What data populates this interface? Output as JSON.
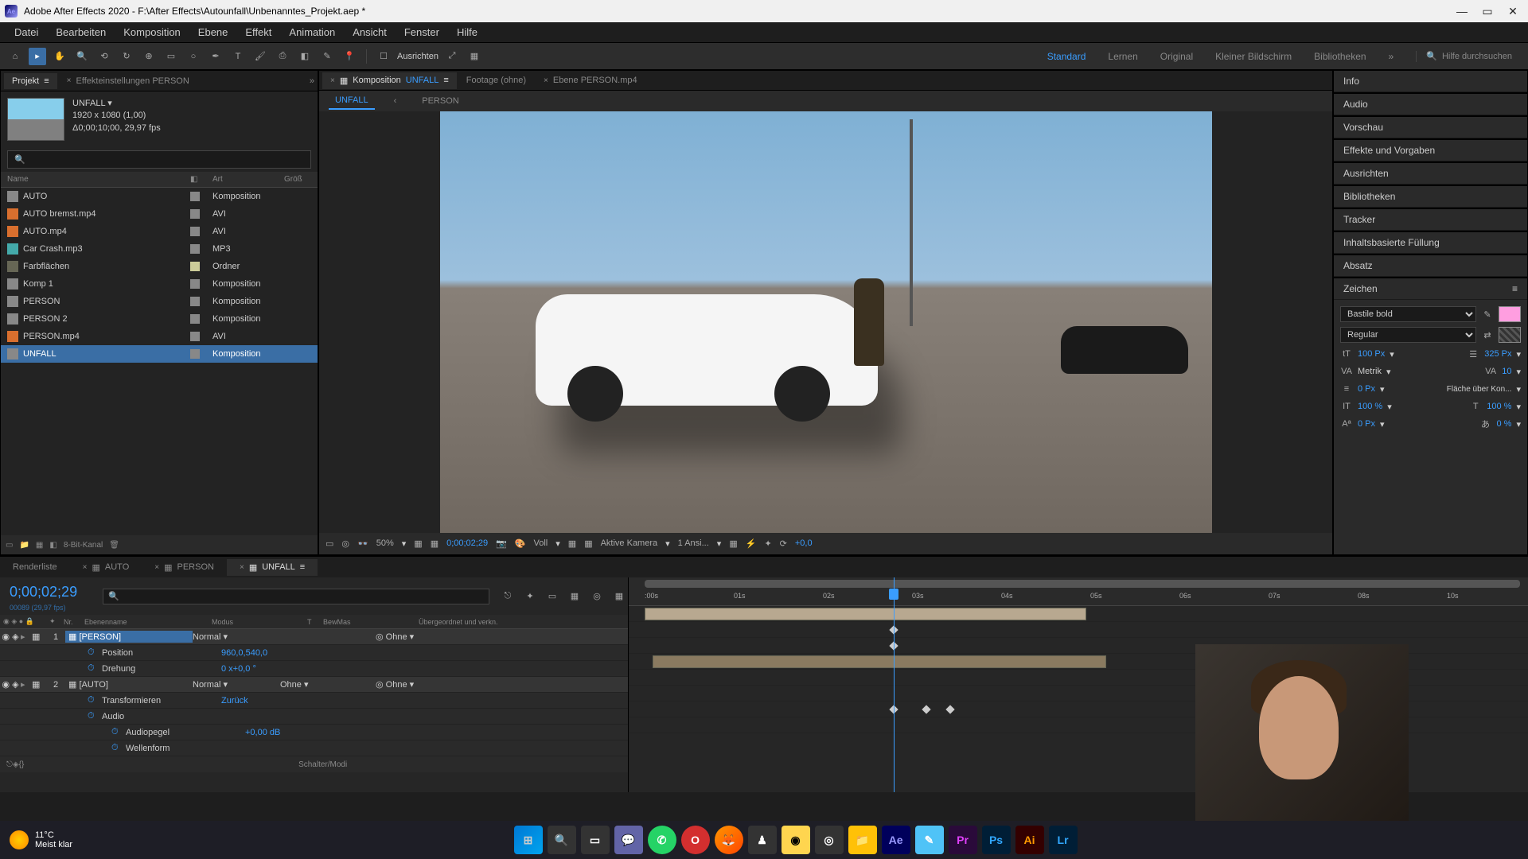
{
  "titlebar": {
    "app": "Adobe After Effects 2020",
    "path": "F:\\After Effects\\Autounfall\\Unbenanntes_Projekt.aep *"
  },
  "menu": [
    "Datei",
    "Bearbeiten",
    "Komposition",
    "Ebene",
    "Effekt",
    "Animation",
    "Ansicht",
    "Fenster",
    "Hilfe"
  ],
  "toolbar": {
    "align_label": "Ausrichten",
    "workspaces": [
      "Standard",
      "Lernen",
      "Original",
      "Kleiner Bildschirm",
      "Bibliotheken"
    ],
    "active_workspace": "Standard",
    "search_placeholder": "Hilfe durchsuchen"
  },
  "project": {
    "tab_project": "Projekt",
    "tab_effects": "Effekteinstellungen PERSON",
    "info_name": "UNFALL ▾",
    "info_res": "1920 x 1080 (1,00)",
    "info_dur": "Δ0;00;10;00, 29,97 fps",
    "cols": {
      "name": "Name",
      "type": "Art",
      "size": "Größ"
    },
    "items": [
      {
        "name": "AUTO",
        "type": "Komposition",
        "icon": "comp",
        "tag": ""
      },
      {
        "name": "AUTO bremst.mp4",
        "type": "AVI",
        "icon": "vid",
        "tag": ""
      },
      {
        "name": "AUTO.mp4",
        "type": "AVI",
        "icon": "vid",
        "tag": ""
      },
      {
        "name": "Car Crash.mp3",
        "type": "MP3",
        "icon": "aud",
        "tag": ""
      },
      {
        "name": "Farbflächen",
        "type": "Ordner",
        "icon": "fold",
        "tag": "y"
      },
      {
        "name": "Komp 1",
        "type": "Komposition",
        "icon": "comp",
        "tag": ""
      },
      {
        "name": "PERSON",
        "type": "Komposition",
        "icon": "comp",
        "tag": ""
      },
      {
        "name": "PERSON 2",
        "type": "Komposition",
        "icon": "comp",
        "tag": ""
      },
      {
        "name": "PERSON.mp4",
        "type": "AVI",
        "icon": "vid",
        "tag": ""
      },
      {
        "name": "UNFALL",
        "type": "Komposition",
        "icon": "comp",
        "tag": "",
        "selected": true
      }
    ],
    "footer_bpc": "8-Bit-Kanal"
  },
  "composition": {
    "tab_comp_prefix": "Komposition",
    "tab_comp_name": "UNFALL",
    "tab_footage": "Footage (ohne)",
    "tab_layer": "Ebene PERSON.mp4",
    "subtab_active": "UNFALL",
    "subtab_other": "PERSON",
    "controls": {
      "zoom": "50%",
      "timecode": "0;00;02;29",
      "res": "Voll",
      "camera": "Aktive Kamera",
      "views": "1 Ansi...",
      "exposure": "+0,0"
    }
  },
  "right_panels": {
    "info": "Info",
    "audio": "Audio",
    "preview": "Vorschau",
    "effects": "Effekte und Vorgaben",
    "align": "Ausrichten",
    "libraries": "Bibliotheken",
    "tracker": "Tracker",
    "contentfill": "Inhaltsbasierte Füllung",
    "paragraph": "Absatz",
    "character": {
      "title": "Zeichen",
      "font": "Bastile bold",
      "style": "Regular",
      "size": "100 Px",
      "leading": "325 Px",
      "kerning": "Metrik",
      "tracking": "10",
      "stroke": "0 Px",
      "stroke_opt": "Fläche über Kon...",
      "vscale": "100 %",
      "hscale": "100 %",
      "baseline": "0 Px",
      "tsume": "0 %"
    }
  },
  "timeline": {
    "tabs": [
      "Renderliste",
      "AUTO",
      "PERSON",
      "UNFALL"
    ],
    "active_tab": "UNFALL",
    "timecode": "0;00;02;29",
    "timecode_sub": "00089 (29,97 fps)",
    "cols": {
      "nr": "Nr.",
      "name": "Ebenenname",
      "mode": "Modus",
      "t": "T",
      "matte": "BewMas",
      "parent": "Übergeordnet und verkn."
    },
    "ruler_ticks": [
      ":00s",
      "01s",
      "02s",
      "03s",
      "04s",
      "05s",
      "06s",
      "07s",
      "08s",
      "10s"
    ],
    "layers": [
      {
        "num": "1",
        "name": "[PERSON]",
        "mode": "Normal",
        "parent": "Ohne",
        "boxed": true,
        "props": [
          {
            "name": "Position",
            "value": "960,0,540,0"
          },
          {
            "name": "Drehung",
            "value": "0 x+0,0 °"
          }
        ]
      },
      {
        "num": "2",
        "name": "[AUTO]",
        "mode": "Normal",
        "matte": "Ohne",
        "parent": "Ohne",
        "props": [
          {
            "name": "Transformieren",
            "value": "Zurück"
          },
          {
            "name": "Audio",
            "value": ""
          },
          {
            "name": "Audiopegel",
            "value": "+0,00 dB",
            "indent": true
          },
          {
            "name": "Wellenform",
            "value": "",
            "indent": true
          }
        ]
      }
    ],
    "footer": "Schalter/Modi"
  },
  "taskbar": {
    "temp": "11°C",
    "cond": "Meist klar"
  }
}
